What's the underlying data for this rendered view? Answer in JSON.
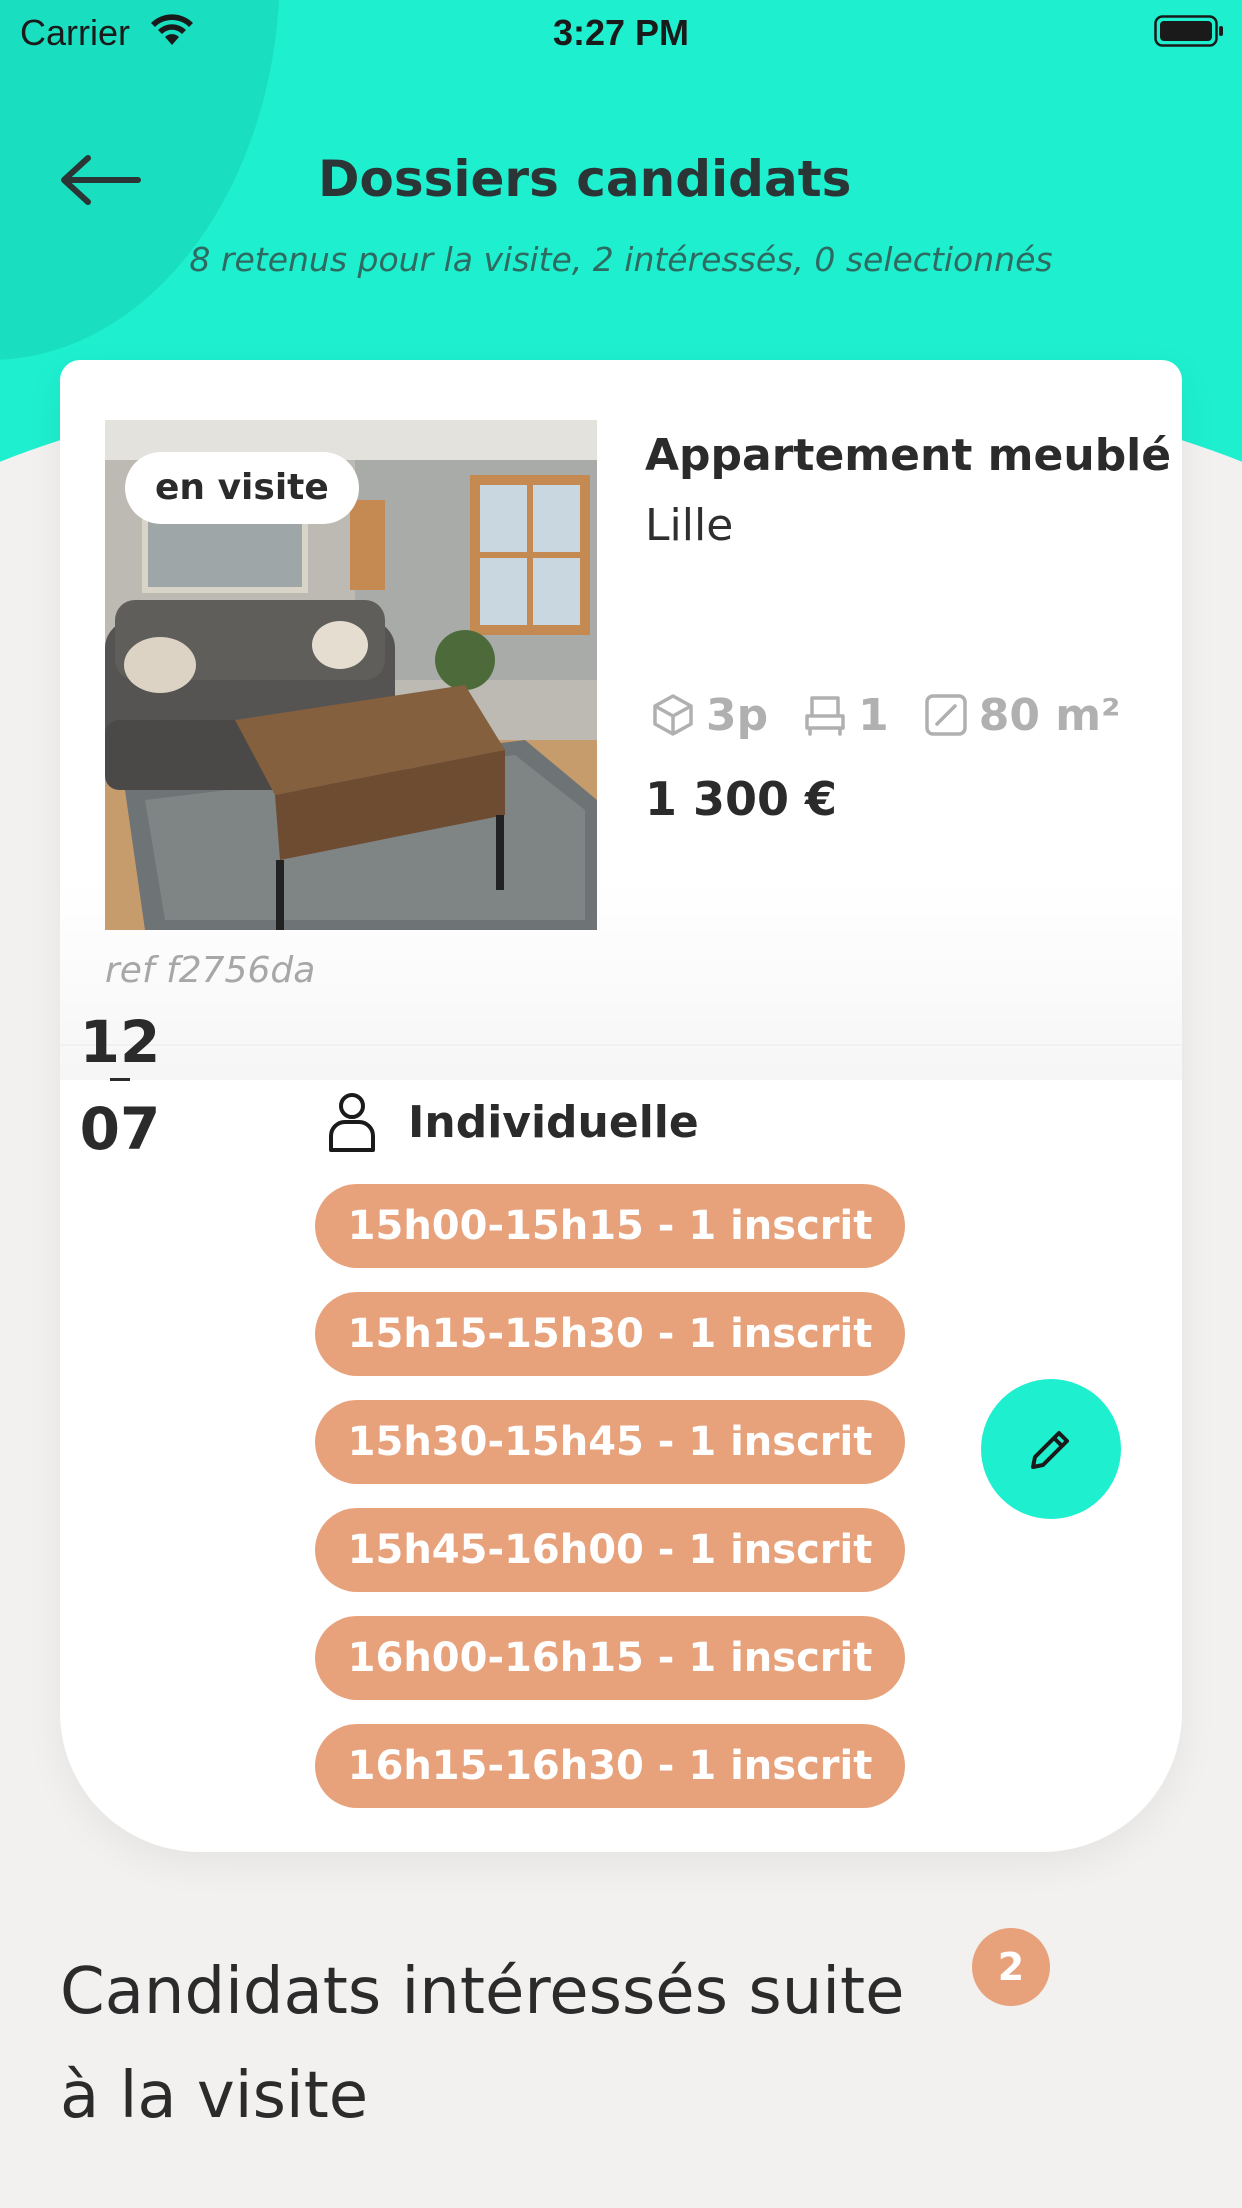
{
  "status_bar": {
    "carrier": "Carrier",
    "time": "3:27 PM"
  },
  "header": {
    "title": "Dossiers candidats",
    "subtitle": "8 retenus pour la visite, 2 intéressés, 0 selectionnés"
  },
  "listing": {
    "badge": "en visite",
    "title": "Appartement meublé",
    "city": "Lille",
    "features": {
      "rooms": "3p",
      "beds": "1",
      "area": "80 m²"
    },
    "price": "1 300 €",
    "ref": "ref f2756da"
  },
  "visit": {
    "date_day": "12",
    "date_month": "07",
    "type": "Individuelle",
    "slots": [
      "15h00-15h15 - 1 inscrit",
      "15h15-15h30 - 1 inscrit",
      "15h30-15h45 - 1 inscrit",
      "15h45-16h00 - 1 inscrit",
      "16h00-16h15 - 1 inscrit",
      "16h15-16h30 - 1 inscrit"
    ]
  },
  "interested": {
    "title": "Candidats intéressés suite à la visite",
    "count": "2"
  },
  "colors": {
    "accent": "#1eefcf",
    "slot": "#e8a27b"
  },
  "icons": {
    "back": "arrow-left-icon",
    "rooms": "cube-icon",
    "beds": "bed-icon",
    "area": "area-icon",
    "person": "person-icon",
    "edit": "pencil-icon"
  }
}
